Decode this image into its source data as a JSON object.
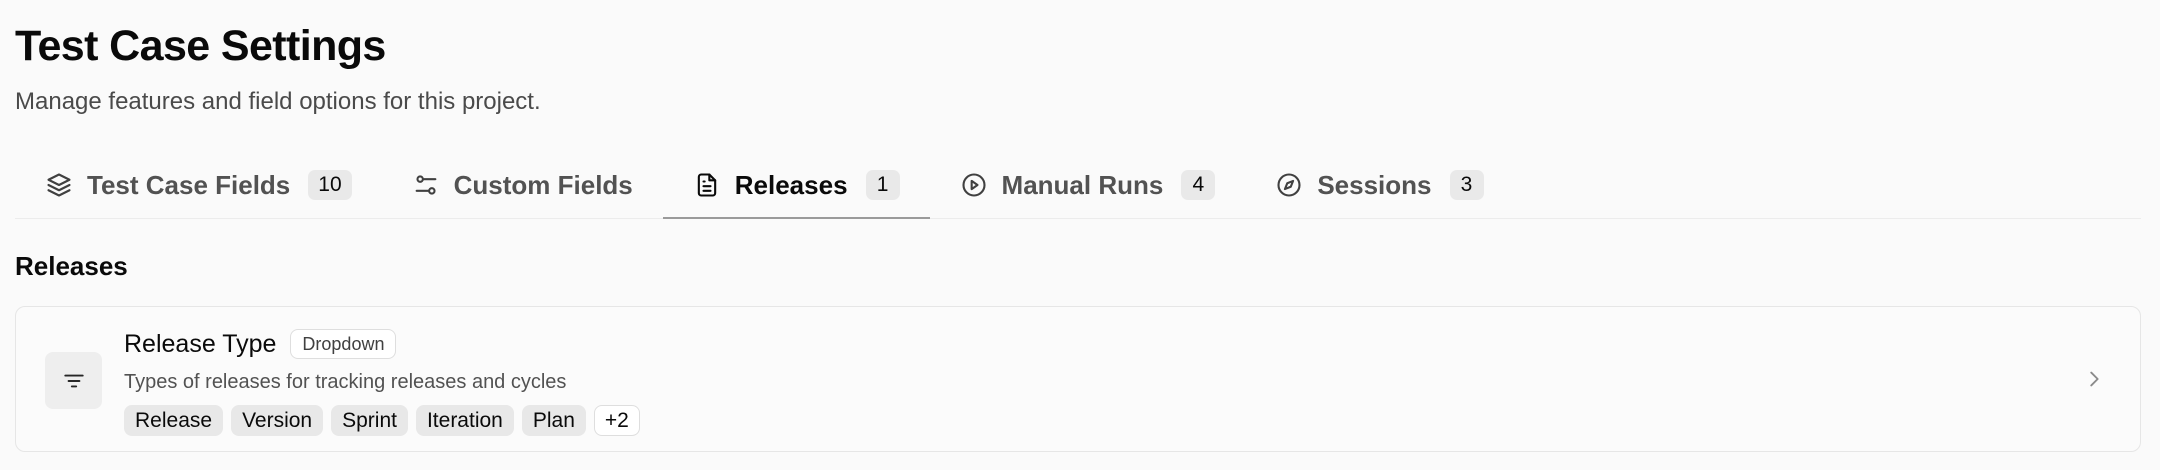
{
  "header": {
    "title": "Test Case Settings",
    "subtitle": "Manage features and field options for this project."
  },
  "tabs": [
    {
      "label": "Test Case Fields",
      "count": "10",
      "icon": "layers-icon"
    },
    {
      "label": "Custom Fields",
      "count": "",
      "icon": "sliders-icon"
    },
    {
      "label": "Releases",
      "count": "1",
      "icon": "document-icon",
      "active": true
    },
    {
      "label": "Manual Runs",
      "count": "4",
      "icon": "play-circle-icon"
    },
    {
      "label": "Sessions",
      "count": "3",
      "icon": "compass-icon"
    }
  ],
  "section": {
    "title": "Releases"
  },
  "fields": [
    {
      "name": "Release Type",
      "type": "Dropdown",
      "description": "Types of releases for tracking releases and cycles",
      "options": [
        "Release",
        "Version",
        "Sprint",
        "Iteration",
        "Plan"
      ],
      "more": "+2",
      "icon": "filter-lines-icon"
    }
  ]
}
